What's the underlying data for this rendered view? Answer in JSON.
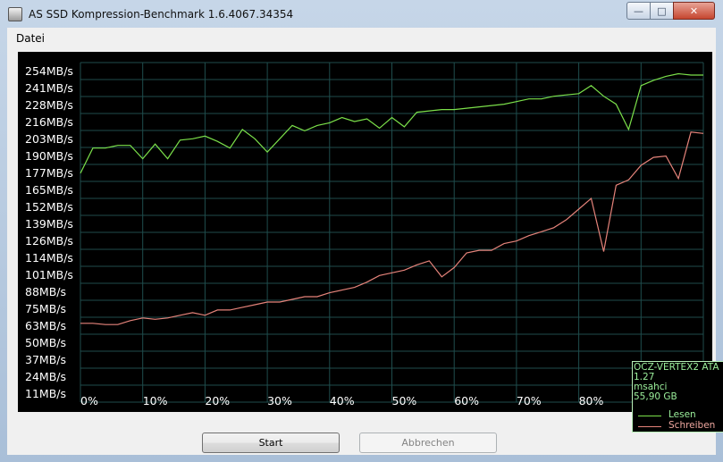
{
  "window": {
    "title": "AS SSD Kompression-Benchmark 1.6.4067.34354",
    "controls": {
      "minimize": "—",
      "maximize": "□",
      "close": "✕"
    }
  },
  "menu": {
    "items": [
      {
        "label": "Datei"
      }
    ]
  },
  "buttons": {
    "start_label": "Start",
    "abort_label": "Abbrechen"
  },
  "legend": {
    "drive": "OCZ-VERTEX2 ATA",
    "firmware": "1.27",
    "driver": "msahci",
    "size": "55,90 GB",
    "read_label": "Lesen",
    "write_label": "Schreiben"
  },
  "colors": {
    "read": "#7be04a",
    "write": "#e5837a",
    "grid": "#1f4d4d",
    "background": "#000000",
    "tick_text": "#ffffff"
  },
  "chart_data": {
    "type": "line",
    "x": [
      0,
      2,
      4,
      6,
      8,
      10,
      12,
      14,
      16,
      18,
      20,
      22,
      24,
      26,
      28,
      30,
      32,
      34,
      36,
      38,
      40,
      42,
      44,
      46,
      48,
      50,
      52,
      54,
      56,
      58,
      60,
      62,
      64,
      66,
      68,
      70,
      72,
      74,
      76,
      78,
      80,
      82,
      84,
      86,
      88,
      90,
      92,
      94,
      96,
      98,
      100
    ],
    "x_tick_labels": [
      "0%",
      "10%",
      "20%",
      "30%",
      "40%",
      "50%",
      "60%",
      "70%",
      "80%",
      "90%",
      "100%"
    ],
    "y_tick_labels": [
      "254MB/s",
      "241MB/s",
      "228MB/s",
      "216MB/s",
      "203MB/s",
      "190MB/s",
      "177MB/s",
      "165MB/s",
      "152MB/s",
      "139MB/s",
      "126MB/s",
      "114MB/s",
      "101MB/s",
      "88MB/s",
      "75MB/s",
      "63MB/s",
      "50MB/s",
      "37MB/s",
      "24MB/s",
      "11MB/s"
    ],
    "xlim": [
      0,
      100
    ],
    "ylim": [
      4.6,
      260.4
    ],
    "grid": true,
    "legend_position": "bottom-right",
    "series": [
      {
        "name": "Lesen",
        "values": [
          177,
          196,
          196,
          198,
          198,
          188,
          199,
          188,
          202,
          203,
          205,
          201,
          196,
          210,
          203,
          193,
          203,
          213,
          209,
          213,
          215,
          219,
          216,
          218,
          211,
          219,
          212,
          223,
          224,
          225,
          225,
          226,
          227,
          228,
          229,
          231,
          233,
          233,
          235,
          236,
          237,
          243,
          235,
          229,
          210,
          243,
          247,
          250,
          252,
          251,
          251
        ]
      },
      {
        "name": "Schreiben",
        "values": [
          64,
          64,
          63,
          63,
          66,
          68,
          67,
          68,
          70,
          72,
          70,
          74,
          74,
          76,
          78,
          80,
          80,
          82,
          84,
          84,
          87,
          89,
          91,
          95,
          100,
          102,
          104,
          108,
          111,
          99,
          106,
          117,
          119,
          119,
          124,
          126,
          130,
          133,
          136,
          142,
          150,
          158,
          118,
          168,
          172,
          183,
          189,
          190,
          173,
          208,
          207
        ]
      }
    ]
  }
}
